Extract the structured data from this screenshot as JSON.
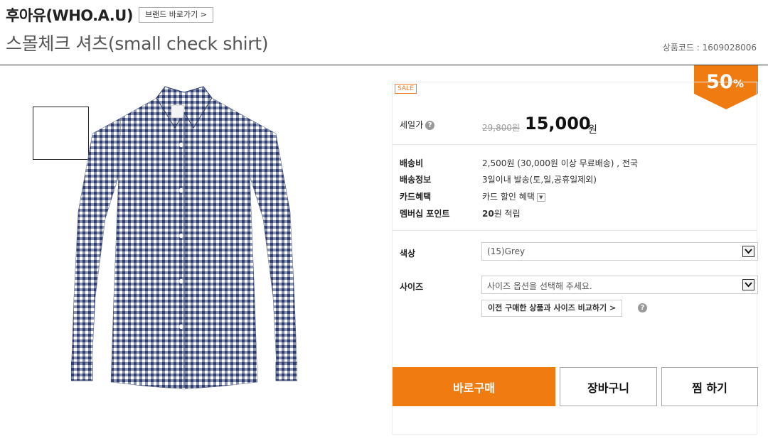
{
  "brand": {
    "name": "후아유(WHO.A.U)",
    "link_label": "브랜드 바로가기 >"
  },
  "product": {
    "title": "스몰체크 셔츠(small check shirt)",
    "code_label": "상품코드 : ",
    "code_value": "1609028006",
    "shirt_colors": {
      "check_dark": "#2e3d6b",
      "check_light": "#ffffff"
    }
  },
  "price": {
    "sale_tag": "SALE",
    "label": "세일가",
    "original": "29,800원",
    "current": "15,000",
    "currency": "원",
    "discount_number": "50",
    "discount_unit": "%"
  },
  "shipping": {
    "fee_label": "배송비",
    "fee_value": "2,500원 (30,000원 이상 무료배송) , 전국",
    "info_label": "배송정보",
    "info_value": "3일이내 발송(토,일,공휴일제외)",
    "card_label": "카드혜택",
    "card_value": "카드 할인 혜택",
    "points_label": "멤버십 포인트",
    "points_amount": "20",
    "points_suffix": "원 적립"
  },
  "options": {
    "color_label": "색상",
    "color_selected": "(15)Grey",
    "size_label": "사이즈",
    "size_placeholder": "사이즈 옵션을 선택해 주세요.",
    "compare_label": "이전 구매한 상품과 사이즈 비교하기 >"
  },
  "actions": {
    "buy_now": "바로구매",
    "cart": "장바구니",
    "wish": "찜 하기"
  },
  "colors": {
    "accent": "#f07b10",
    "help_icon": "#999999"
  }
}
